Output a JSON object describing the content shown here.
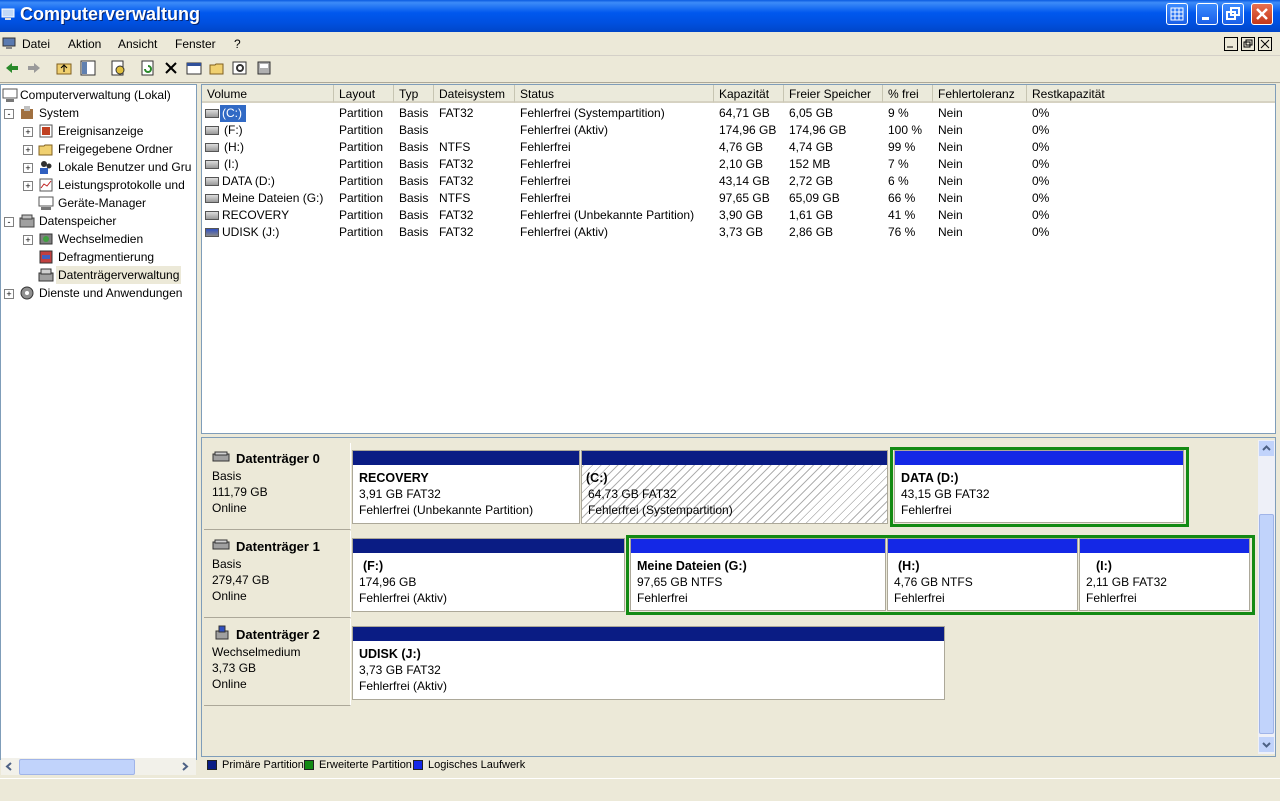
{
  "window": {
    "title": "Computerverwaltung"
  },
  "menu": [
    "Datei",
    "Aktion",
    "Ansicht",
    "Fenster",
    "?"
  ],
  "tree": {
    "root": "Computerverwaltung (Lokal)",
    "system": "System",
    "ereignis": "Ereignisanzeige",
    "freigegeben": "Freigegebene Ordner",
    "benutzer": "Lokale Benutzer und Gru",
    "leistung": "Leistungsprotokolle und",
    "geraete": "Geräte-Manager",
    "datenspeicher": "Datenspeicher",
    "wechsel": "Wechselmedien",
    "defrag": "Defragmentierung",
    "dtverw": "Datenträgerverwaltung",
    "dienste": "Dienste und Anwendungen"
  },
  "columns": [
    "Volume",
    "Layout",
    "Typ",
    "Dateisystem",
    "Status",
    "Kapazität",
    "Freier Speicher",
    "% frei",
    "Fehlertoleranz",
    "Restkapazität"
  ],
  "volumes": [
    [
      "(C:)",
      "Partition",
      "Basis",
      "FAT32",
      "Fehlerfrei (Systempartition)",
      "64,71 GB",
      "6,05 GB",
      "9 %",
      "Nein",
      "0%"
    ],
    [
      "(F:)",
      "Partition",
      "Basis",
      "",
      "Fehlerfrei (Aktiv)",
      "174,96 GB",
      "174,96 GB",
      "100 %",
      "Nein",
      "0%"
    ],
    [
      "(H:)",
      "Partition",
      "Basis",
      "NTFS",
      "Fehlerfrei",
      "4,76 GB",
      "4,74 GB",
      "99 %",
      "Nein",
      "0%"
    ],
    [
      "(I:)",
      "Partition",
      "Basis",
      "FAT32",
      "Fehlerfrei",
      "2,10 GB",
      "152 MB",
      "7 %",
      "Nein",
      "0%"
    ],
    [
      "DATA (D:)",
      "Partition",
      "Basis",
      "FAT32",
      "Fehlerfrei",
      "43,14 GB",
      "2,72 GB",
      "6 %",
      "Nein",
      "0%"
    ],
    [
      "Meine Dateien (G:)",
      "Partition",
      "Basis",
      "NTFS",
      "Fehlerfrei",
      "97,65 GB",
      "65,09 GB",
      "66 %",
      "Nein",
      "0%"
    ],
    [
      "RECOVERY",
      "Partition",
      "Basis",
      "FAT32",
      "Fehlerfrei (Unbekannte Partition)",
      "3,90 GB",
      "1,61 GB",
      "41 %",
      "Nein",
      "0%"
    ],
    [
      "UDISK (J:)",
      "Partition",
      "Basis",
      "FAT32",
      "Fehlerfrei (Aktiv)",
      "3,73 GB",
      "2,86 GB",
      "76 %",
      "Nein",
      "0%"
    ]
  ],
  "disks": [
    {
      "name": "Datenträger 0",
      "type": "Basis",
      "size": "111,79 GB",
      "state": "Online",
      "parts": [
        {
          "name": "RECOVERY",
          "size": "3,91 GB FAT32",
          "status": "Fehlerfrei (Unbekannte Partition)"
        },
        {
          "name": "(C:)",
          "size": "64,73 GB FAT32",
          "status": "Fehlerfrei (Systempartition)"
        },
        {
          "name": "DATA  (D:)",
          "size": "43,15 GB FAT32",
          "status": "Fehlerfrei"
        }
      ]
    },
    {
      "name": "Datenträger 1",
      "type": "Basis",
      "size": "279,47 GB",
      "state": "Online",
      "parts": [
        {
          "name": "(F:)",
          "size": "174,96 GB",
          "status": "Fehlerfrei (Aktiv)"
        },
        {
          "name": "Meine Dateien  (G:)",
          "size": "97,65 GB NTFS",
          "status": "Fehlerfrei"
        },
        {
          "name": "(H:)",
          "size": "4,76 GB NTFS",
          "status": "Fehlerfrei"
        },
        {
          "name": "(I:)",
          "size": "2,11 GB FAT32",
          "status": "Fehlerfrei"
        }
      ]
    },
    {
      "name": "Datenträger 2",
      "type": "Wechselmedium",
      "size": "3,73 GB",
      "state": "Online",
      "parts": [
        {
          "name": "UDISK  (J:)",
          "size": "3,73 GB FAT32",
          "status": "Fehlerfrei (Aktiv)"
        }
      ]
    }
  ],
  "legend": [
    "Primäre Partition",
    "Erweiterte Partition",
    "Logisches Laufwerk"
  ],
  "colors": {
    "primary": "#0a1c84",
    "extended": "#138a13",
    "logical": "#1428e6",
    "titlebar": "#0058ee"
  }
}
